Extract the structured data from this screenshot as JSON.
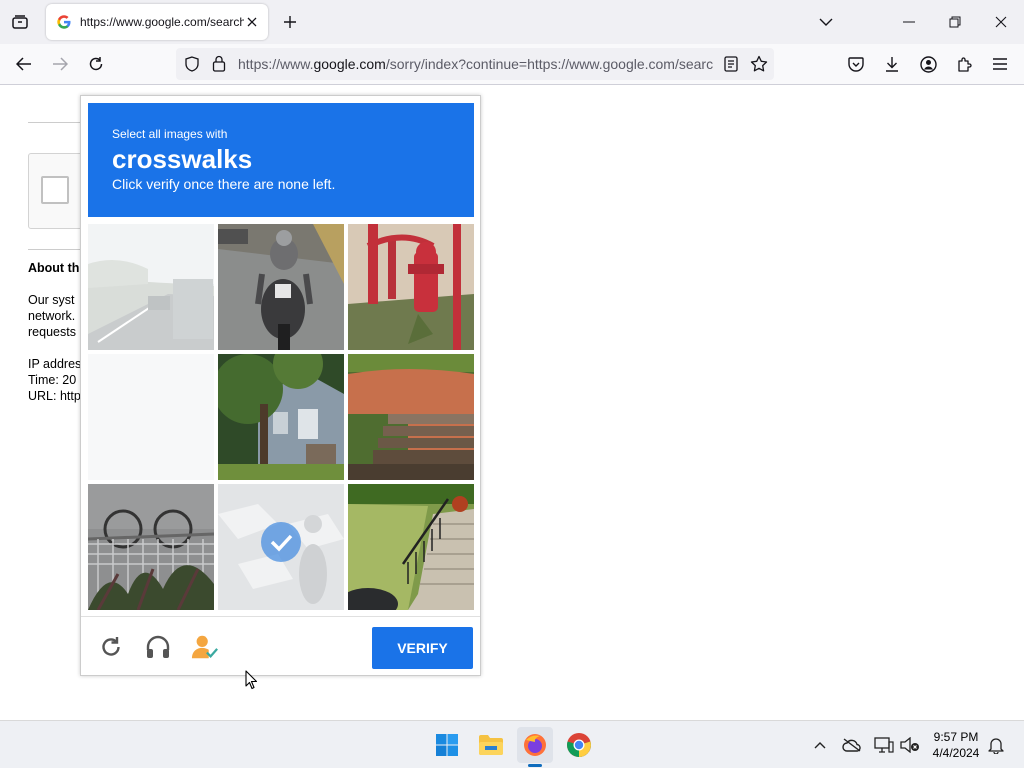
{
  "browser": {
    "tab": {
      "title": "https://www.google.com/search?q="
    },
    "url": {
      "prefix": "https://www.",
      "host": "google.com",
      "rest": "/sorry/index?continue=https://www.google.com/search"
    }
  },
  "page": {
    "about_title": "About th",
    "about_lines": [
      "Our syst",
      "network.",
      "requests"
    ],
    "info_lines": [
      "IP addres",
      "Time: 20",
      "URL: http"
    ]
  },
  "captcha": {
    "subtitle": "Select all images with",
    "keyword": "crosswalks",
    "instruction": "Click verify once there are none left.",
    "verify_label": "VERIFY",
    "tiles": [
      {
        "name": "tile-road-fog",
        "selected": false
      },
      {
        "name": "tile-motorcycle",
        "selected": false
      },
      {
        "name": "tile-hydrant",
        "selected": false
      },
      {
        "name": "tile-blank",
        "selected": false
      },
      {
        "name": "tile-house",
        "selected": false
      },
      {
        "name": "tile-steps-wall",
        "selected": false
      },
      {
        "name": "tile-fence",
        "selected": false
      },
      {
        "name": "tile-motorcycle-crosswalk",
        "selected": true
      },
      {
        "name": "tile-stairs-railing",
        "selected": false
      }
    ]
  },
  "taskbar": {
    "time": "9:57 PM",
    "date": "4/4/2024"
  },
  "colors": {
    "accent": "#1a73e8"
  }
}
